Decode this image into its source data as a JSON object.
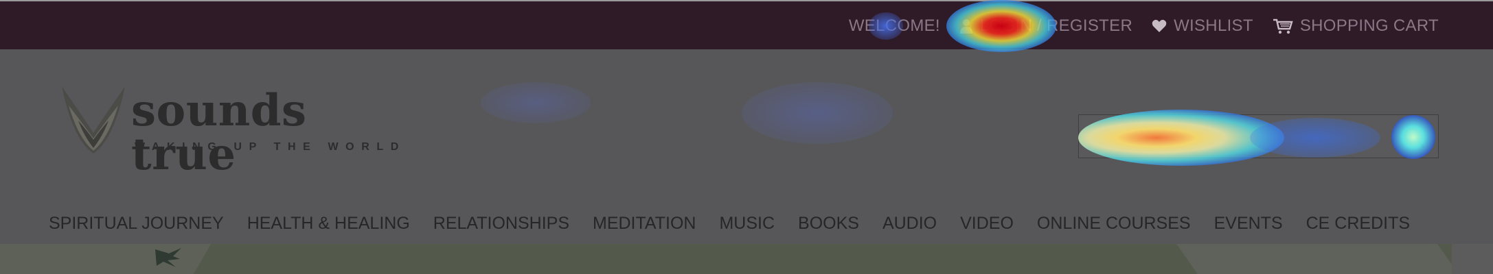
{
  "topbar": {
    "welcome": "WELCOME!",
    "login_register": "LOGIN / REGISTER",
    "wishlist": "WISHLIST",
    "shopping_cart": "SHOPPING CART"
  },
  "logo": {
    "wordmark": "sounds true",
    "tagline": "WAKING UP THE WORLD"
  },
  "search": {
    "placeholder": ""
  },
  "nav": {
    "items": [
      "SPIRITUAL JOURNEY",
      "HEALTH & HEALING",
      "RELATIONSHIPS",
      "MEDITATION",
      "MUSIC",
      "BOOKS",
      "AUDIO",
      "VIDEO",
      "ONLINE COURSES",
      "EVENTS",
      "CE CREDITS"
    ]
  },
  "icons": {
    "user": "user-icon",
    "wishlist": "heart-icon",
    "cart": "cart-icon",
    "search": "search-icon",
    "logo": "wings-logo-icon"
  },
  "colors": {
    "topbar_bg": "#2f1a27",
    "header_bg": "#575759",
    "text_dark": "#262626",
    "top_link": "#8a7886"
  }
}
